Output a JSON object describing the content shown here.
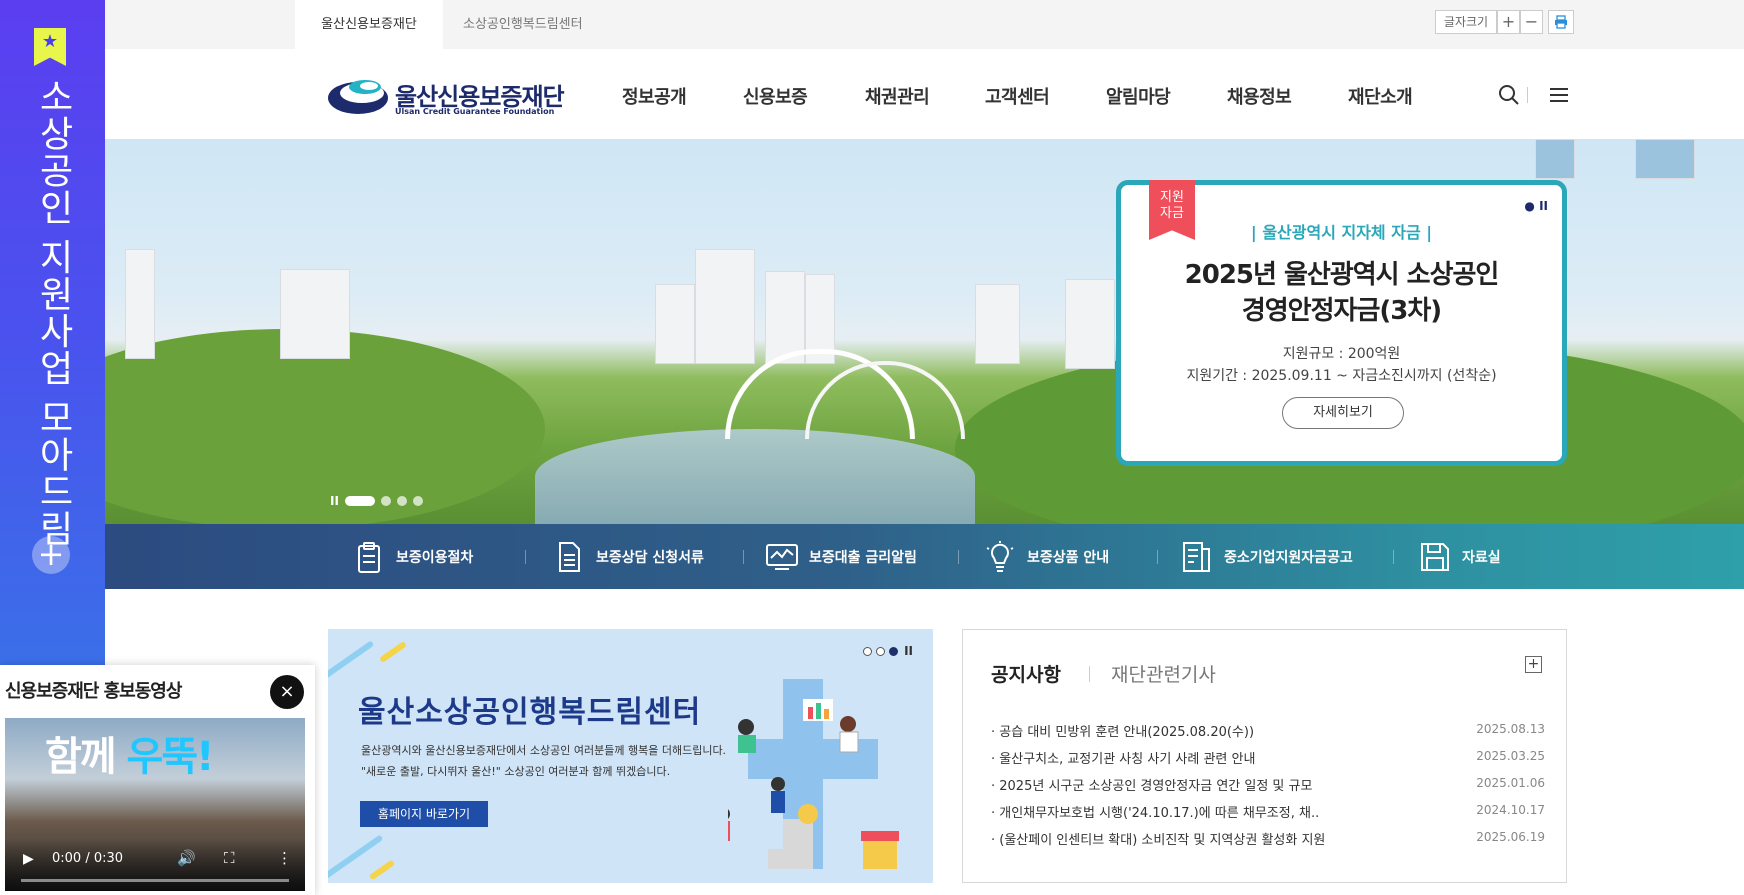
{
  "side_banner": {
    "text": "소상공인 지원사업 모아드림",
    "plus": "+"
  },
  "topbar": {
    "tabs": [
      {
        "label": "울산신용보증재단"
      },
      {
        "label": "소상공인행복드림센터"
      }
    ],
    "font_size_label": "글자크기",
    "font_plus": "+",
    "font_minus": "−",
    "print_icon": "print-icon"
  },
  "header": {
    "logo_title": "울산신용보증재단",
    "logo_sub": "Ulsan Credit Guarantee Foundation",
    "nav": [
      {
        "label": "정보공개"
      },
      {
        "label": "신용보증"
      },
      {
        "label": "채권관리"
      },
      {
        "label": "고객센터"
      },
      {
        "label": "알림마당"
      },
      {
        "label": "채용정보"
      },
      {
        "label": "재단소개"
      }
    ],
    "icons": [
      "search-icon",
      "menu-icon"
    ]
  },
  "hero": {
    "slide_controls": {
      "pause": "II",
      "dots": 5,
      "active": 0
    },
    "promo": {
      "badge": "지원\n자금",
      "controls": "● II",
      "category": "|  울산광역시 지자체 자금  |",
      "title_line1": "2025년 울산광역시 소상공인",
      "title_line2": "경영안정자금(3차)",
      "scale": "지원규모 : 200억원",
      "period": "지원기간 : 2025.09.11 ~ 자금소진시까지 (선착순)",
      "button": "자세히보기"
    }
  },
  "quicklinks": [
    {
      "label": "보증이용절차",
      "icon": "clipboard-icon"
    },
    {
      "label": "보증상담 신청서류",
      "icon": "document-icon"
    },
    {
      "label": "보증대출 금리알림",
      "icon": "chart-monitor-icon"
    },
    {
      "label": "보증상품 안내",
      "icon": "lightbulb-icon"
    },
    {
      "label": "중소기업지원자금공고",
      "icon": "file-list-icon"
    },
    {
      "label": "자료실",
      "icon": "save-disk-icon"
    }
  ],
  "dream": {
    "title": "울산소상공인행복드림센터",
    "desc1": "울산광역시와 울산신용보증재단에서 소상공인 여러분들께 행복을 더해드립니다.",
    "desc2": "\"새로운 출발, 다시뛰자 울산!\" 소상공인 여러분과 함께 뛰겠습니다.",
    "button": "홈페이지 바로가기",
    "slide_controls": {
      "dots": 3,
      "active": 2,
      "pause": "II"
    }
  },
  "notice": {
    "tab_active": "공지사항",
    "tab_inactive": "재단관련기사",
    "more": "+",
    "items": [
      {
        "title": "공습 대비 민방위 훈련 안내(2025.08.20(수))",
        "date": "2025.08.13"
      },
      {
        "title": "울산구치소, 교정기관 사칭 사기 사례 관련 안내",
        "date": "2025.03.25"
      },
      {
        "title": "2025년 시구군 소상공인 경영안정자금 연간 일정 및 규모",
        "date": "2025.01.06"
      },
      {
        "title": "개인채무자보호법 시행('24.10.17.)에 따른 채무조정, 채..",
        "date": "2024.10.17"
      },
      {
        "title": "(울산페이 인센티브 확대) 소비진작 및 지역상권 활성화 지원",
        "date": "2025.06.19"
      }
    ]
  },
  "video": {
    "title": "신용보증재단 홍보동영상",
    "close": "×",
    "overlay_a": "함께",
    "overlay_b": "우뚝!",
    "time": "0:00 / 0:30",
    "play": "▶",
    "volume": "🔊",
    "fullscreen": "⛶",
    "menu": "⋮"
  },
  "colors": {
    "brand_navy": "#1d2a6b",
    "accent_teal": "#2aa7b8",
    "badge_red": "#ef4f5a",
    "side_purple": "#5b3ef0"
  }
}
